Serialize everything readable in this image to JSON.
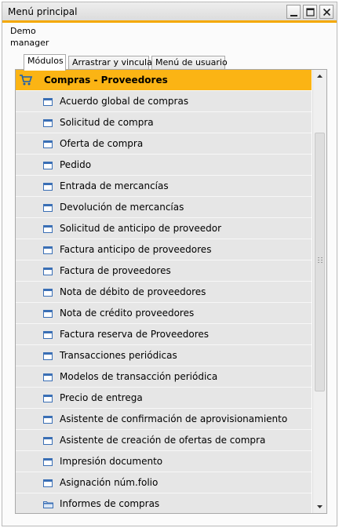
{
  "window": {
    "title": "Menú principal",
    "controls": {
      "minimize": "minimize",
      "maximize": "maximize",
      "close": "close"
    }
  },
  "user": {
    "line1": "Demo",
    "line2": "manager"
  },
  "tabs": [
    {
      "label": "Módulos",
      "active": true
    },
    {
      "label": "Arrastrar y vincular",
      "active": false
    },
    {
      "label": "Menú de usuario",
      "active": false
    }
  ],
  "module": {
    "label": "Compras - Proveedores",
    "icon": "shopping-cart-icon",
    "header_color": "#fbb414",
    "items": [
      {
        "label": "Acuerdo global de compras",
        "icon": "form-icon"
      },
      {
        "label": "Solicitud de compra",
        "icon": "form-icon"
      },
      {
        "label": "Oferta de compra",
        "icon": "form-icon"
      },
      {
        "label": "Pedido",
        "icon": "form-icon"
      },
      {
        "label": "Entrada de mercancías",
        "icon": "form-icon"
      },
      {
        "label": "Devolución de mercancías",
        "icon": "form-icon"
      },
      {
        "label": "Solicitud de anticipo de proveedor",
        "icon": "form-icon"
      },
      {
        "label": "Factura anticipo de proveedores",
        "icon": "form-icon"
      },
      {
        "label": "Factura de proveedores",
        "icon": "form-icon"
      },
      {
        "label": "Nota de débito de proveedores",
        "icon": "form-icon"
      },
      {
        "label": "Nota de crédito proveedores",
        "icon": "form-icon"
      },
      {
        "label": "Factura reserva de Proveedores",
        "icon": "form-icon"
      },
      {
        "label": "Transacciones periódicas",
        "icon": "form-icon"
      },
      {
        "label": "Modelos de transacción periódica",
        "icon": "form-icon"
      },
      {
        "label": "Precio de entrega",
        "icon": "form-icon"
      },
      {
        "label": "Asistente de confirmación de aprovisionamiento",
        "icon": "form-icon"
      },
      {
        "label": "Asistente de creación de ofertas de compra",
        "icon": "form-icon"
      },
      {
        "label": "Impresión documento",
        "icon": "form-icon"
      },
      {
        "label": "Asignación núm.folio",
        "icon": "form-icon"
      },
      {
        "label": "Informes de compras",
        "icon": "folder-icon"
      }
    ]
  },
  "colors": {
    "accent": "#f4a800",
    "item_bg": "#e6e6e6",
    "icon_blue": "#3a6fb5"
  }
}
